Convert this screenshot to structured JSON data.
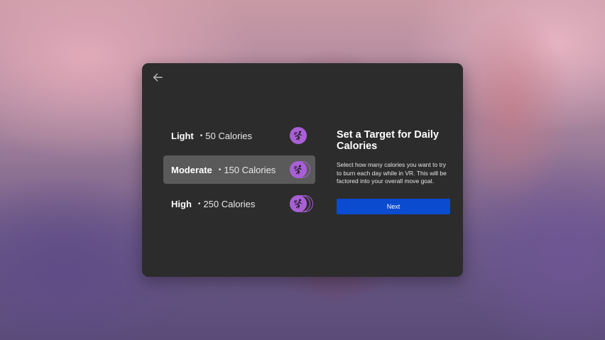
{
  "background": {
    "description_colors": [
      "#c99aa6",
      "#6d5a88"
    ]
  },
  "dialog": {
    "back_icon": "arrow-left-icon",
    "options": [
      {
        "name": "Light",
        "separator": "•",
        "calories": "50 Calories",
        "selected": false,
        "icon": "running-person-icon",
        "level": 1
      },
      {
        "name": "Moderate",
        "separator": "•",
        "calories": "150 Calories",
        "selected": true,
        "icon": "running-person-icon",
        "level": 2
      },
      {
        "name": "High",
        "separator": "•",
        "calories": "250 Calories",
        "selected": false,
        "icon": "running-person-icon",
        "level": 3
      }
    ],
    "title": "Set a Target for Daily Calories",
    "description": "Select how many calories you want to try to burn each day while in VR. This will be factored into your overall move goal.",
    "next_label": "Next"
  },
  "colors": {
    "panel": "#2c2c2c",
    "selected_row": "#5a5a5a",
    "accent_purple": "#a95fd6",
    "primary_button": "#0a4bd0"
  }
}
